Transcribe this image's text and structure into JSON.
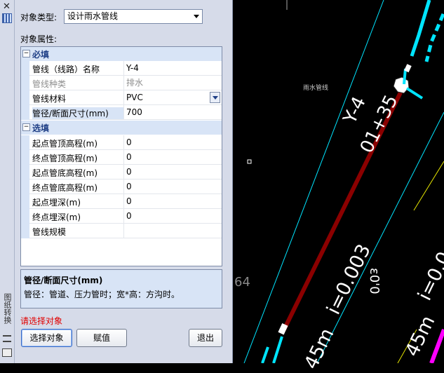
{
  "panel": {
    "type_label": "对象类型:",
    "type_value": "设计雨水管线",
    "props_label": "对象属性:",
    "categories": [
      {
        "title": "必填",
        "toggle": "−",
        "rows": [
          {
            "name": "管线（线路）名称",
            "value": "Y-4"
          },
          {
            "name": "管线种类",
            "value": "排水"
          },
          {
            "name": "管线材料",
            "value": "PVC"
          },
          {
            "name": "管径/断面尺寸(mm)",
            "value": "700"
          }
        ]
      },
      {
        "title": "选填",
        "toggle": "−",
        "rows": [
          {
            "name": "起点管顶高程(m)",
            "value": "0"
          },
          {
            "name": "终点管顶高程(m)",
            "value": "0"
          },
          {
            "name": "起点管底高程(m)",
            "value": "0"
          },
          {
            "name": "终点管底高程(m)",
            "value": "0"
          },
          {
            "name": "起点埋深(m)",
            "value": "0"
          },
          {
            "name": "终点埋深(m)",
            "value": "0"
          },
          {
            "name": "管线规模",
            "value": ""
          }
        ]
      }
    ],
    "desc_title": "管径/断面尺寸(mm)",
    "desc_text": "管径：管道、压力管时；宽*高：方沟时。",
    "status": "请选择对象",
    "buttons": {
      "select": "选择对象",
      "assign": "赋值",
      "exit": "退出"
    }
  },
  "dock": {
    "vertical_label": "图纸转换",
    "close": "✕"
  },
  "cad": {
    "pipe_label": "Y-4",
    "station": "01+35",
    "slope_1": "i=0.003",
    "slope_2": "i=0.0",
    "length_1": "45m",
    "length_2": "45m",
    "small_text": "64",
    "rotated_small": "ε0'0",
    "tiny_text": "雨水管线"
  },
  "colors": {
    "pipe": "#8b0000",
    "cyan": "#00e5ff",
    "yellow": "#e6e600",
    "magenta": "#ff00ff",
    "panel_bg": "#d6dbe9"
  }
}
